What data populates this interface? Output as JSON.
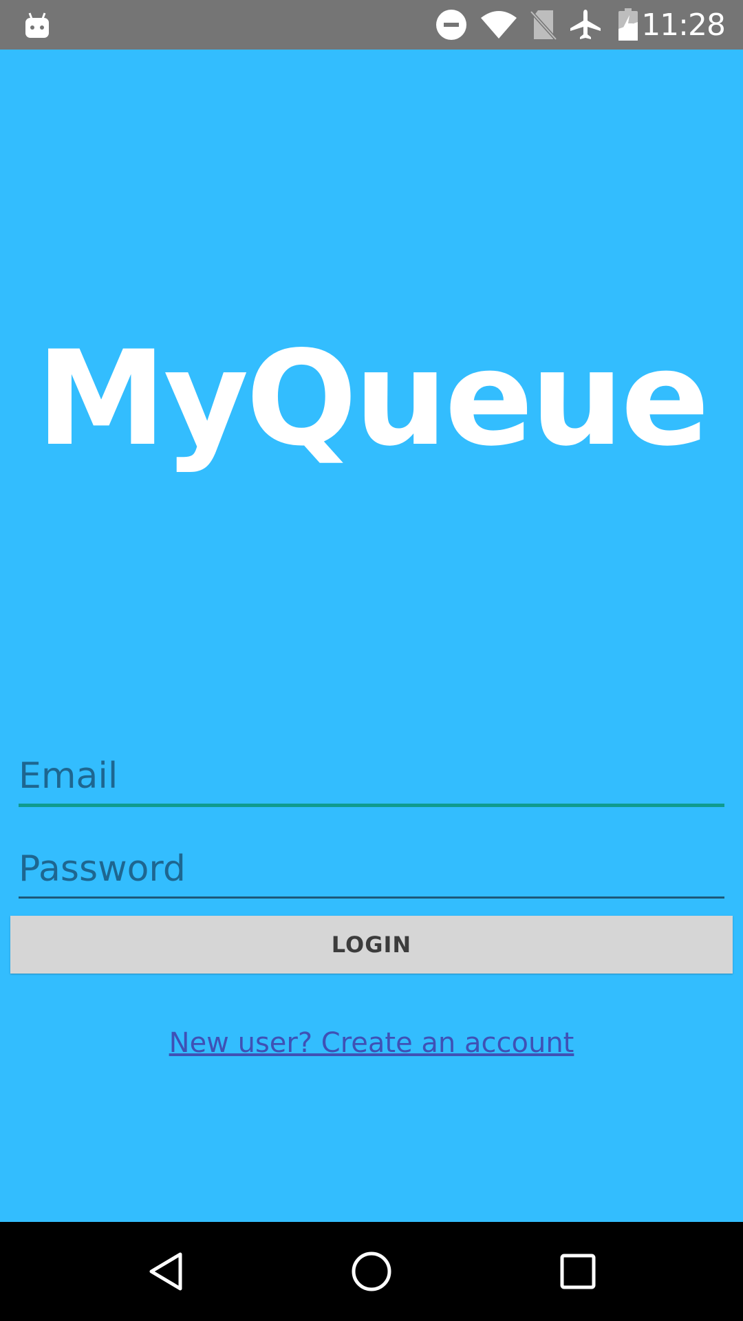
{
  "status_bar": {
    "time": "11:28",
    "icons": [
      "android-notification-icon",
      "do-not-disturb-icon",
      "wifi-icon",
      "no-sim-icon",
      "airplane-mode-icon",
      "battery-charging-icon"
    ]
  },
  "app": {
    "title": "MyQueue"
  },
  "form": {
    "email_placeholder": "Email",
    "password_placeholder": "Password",
    "login_label": "LOGIN",
    "create_account_link": "New user? Create an account"
  },
  "nav_bar": {
    "icons": [
      "back-icon",
      "home-icon",
      "recents-icon"
    ]
  },
  "colors": {
    "background": "#33bdfe",
    "status_bar": "#757575",
    "field_focus_line": "#0f9b8e",
    "button": "#d6d6d6",
    "link": "#3f51b5"
  }
}
